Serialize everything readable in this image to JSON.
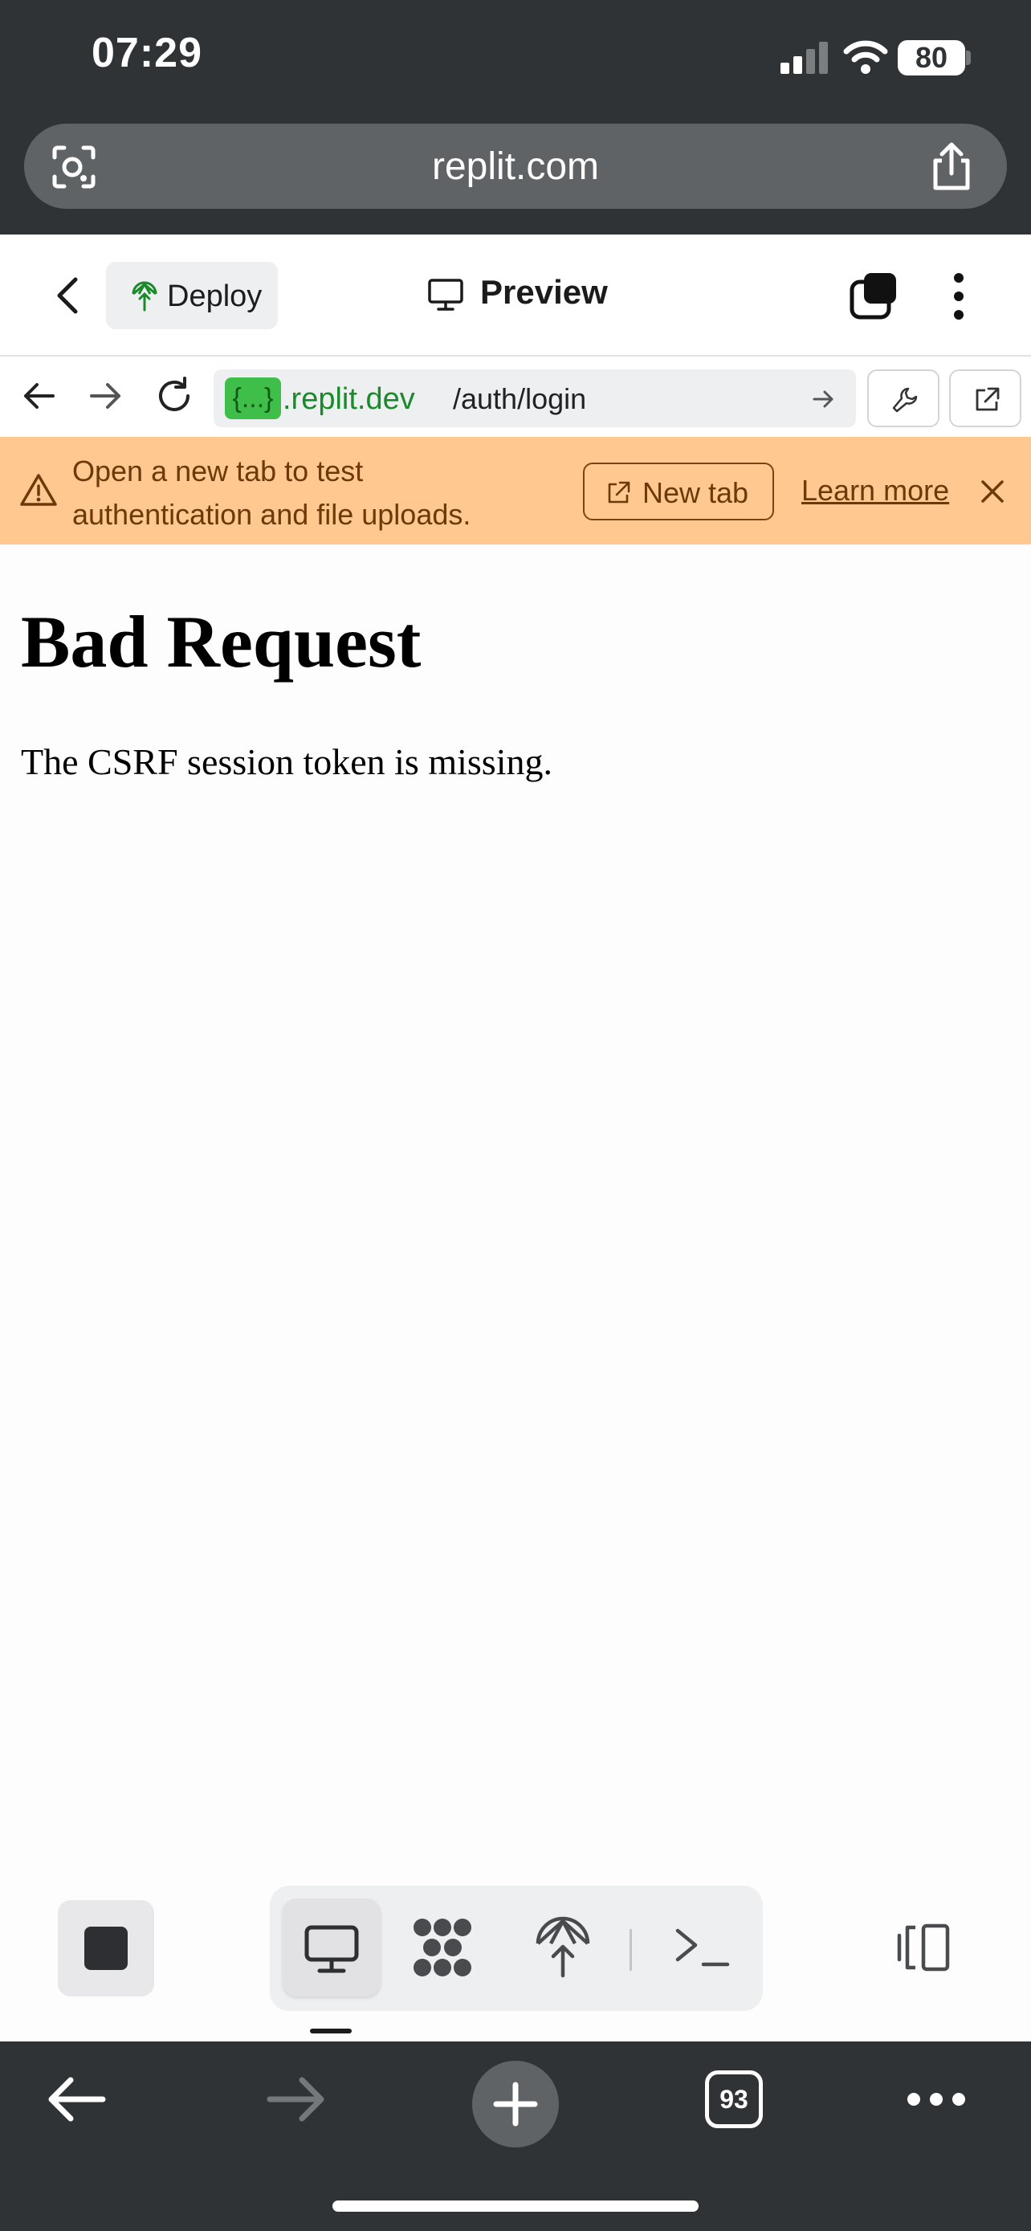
{
  "status_bar": {
    "time": "07:29",
    "battery": "80",
    "icons": [
      "signal-icon",
      "wifi-icon",
      "battery-icon"
    ]
  },
  "browser": {
    "address": "replit.com",
    "icons": [
      "lens-icon",
      "share-icon"
    ],
    "bottom_bar": {
      "tab_count": "93",
      "icons": [
        "back-arrow-icon",
        "forward-arrow-icon",
        "plus-icon",
        "tabs-count-icon",
        "more-dots-icon"
      ]
    }
  },
  "replit_header": {
    "deploy_label": "Deploy",
    "title": "Preview",
    "icons": [
      "chevron-left-icon",
      "deploy-icon",
      "monitor-icon",
      "tabs-stack-icon",
      "kebab-icon"
    ]
  },
  "preview_toolbar": {
    "url_badge": "{...}",
    "url_domain": ".replit.dev",
    "url_path": "/auth/login",
    "icons": [
      "arrow-left-icon",
      "arrow-right-icon",
      "reload-icon",
      "go-arrow-icon",
      "wrench-icon",
      "external-link-icon"
    ]
  },
  "banner": {
    "line1": "Open a new tab to test",
    "line2": "authentication and file uploads.",
    "new_tab_label": "New tab",
    "learn_more_label": "Learn more",
    "background": "#ffc890",
    "text_color": "#6b3a08"
  },
  "page": {
    "heading": "Bad Request",
    "message": "The CSRF session token is missing."
  },
  "bottom_toolbar": {
    "icons": [
      "stop-icon",
      "monitor-icon",
      "workflows-icon",
      "deploy-icon",
      "terminal-icon",
      "panels-icon"
    ]
  },
  "colors": {
    "chrome_dark": "#303336",
    "url_green": "#1a8a2a",
    "badge_green": "#3fbf4a"
  }
}
